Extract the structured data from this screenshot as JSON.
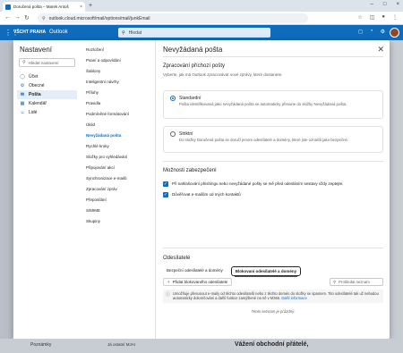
{
  "browser": {
    "tab_title": "Doručená pošta – Marek Antoš",
    "tab_close": "×",
    "new_tab": "+",
    "url": "outlook.cloud.microsoft/mail/options/mail/junkEmail",
    "win_min": "–",
    "win_max": "□",
    "win_close": "×"
  },
  "outlook": {
    "brand": "VŠCHT PRAHA",
    "app_title": "Outlook",
    "search_placeholder": "Hledat"
  },
  "settings": {
    "title": "Nastavení",
    "search_placeholder": "Hledat nastavení",
    "categories": [
      {
        "label": "Účet",
        "icon": "person-icon"
      },
      {
        "label": "Obecné",
        "icon": "gear-icon"
      },
      {
        "label": "Pošta",
        "icon": "mail-icon"
      },
      {
        "label": "Kalendář",
        "icon": "calendar-icon"
      },
      {
        "label": "Lidé",
        "icon": "people-icon"
      }
    ],
    "selected_category": "Pošta",
    "subitems": [
      "Rozložení",
      "Psaní a odpovídání",
      "Šablony",
      "Inteligentní návrhy",
      "Přílohy",
      "Pravidla",
      "Podmíněné formátování",
      "Úklid",
      "Nevyžádaná pošta",
      "Rychlé kroky",
      "Složky pro vyhledávání",
      "Připojování akcí",
      "Synchronizace e-mailů",
      "Zpracování zpráv",
      "Přeposílání",
      "S/MIME",
      "Skupiny"
    ],
    "selected_subitem": "Nevyžádaná pošta"
  },
  "junk": {
    "title": "Nevyžádaná pošta",
    "filtering_heading": "Zpracování příchozí pošty",
    "filtering_desc": "Vyberte, jak má Outlook zpracovávat nové zprávy, které dostanete.",
    "options": [
      {
        "label": "Standardní",
        "desc": "Pošta identifikovaná jako nevyžádaná pošta se automaticky přesune do složky Nevyžádaná pošta.",
        "selected": true
      },
      {
        "label": "Striktní",
        "desc": "Do složky Doručená pošta se doručí jenom odesílatelé a domény, které jste označili jako bezpečné.",
        "selected": false
      }
    ],
    "security_heading": "Možnosti zabezpečení",
    "security_options": [
      {
        "label": "Při nahlašování phishingu nebo nevyžádané pošty se mě před odesláním sestavy vždy zeptejte.",
        "checked": true
      },
      {
        "label": "Důvěřovat e-mailům od mých kontaktů",
        "checked": true
      }
    ],
    "senders_heading": "Odesílatelé",
    "tabs": [
      "Bezpeční odesílatelé a domény",
      "Blokovaní odesílatelé a domény"
    ],
    "active_tab": "Blokovaní odesílatelé a domény",
    "add_button": "Přidat blokovaného odesílatele",
    "filter_placeholder": "Prohledat seznam",
    "info_text": "Umožňuje přesunout e-maily od těchto odesílatelů nebo z těchto domén do složky se spamem. Tito odesílatelé tak už nebudou automaticky dokončováni a další funkce zamýšlené na ně v M365.",
    "info_link": "Další informace",
    "empty_text": "Tento seznam je prázdný."
  },
  "background": {
    "bottom_left": "Poznámky",
    "bottom_mid": "Já ostatní MJAI",
    "bottom_heading": "Vážení obchodní přátelé,"
  }
}
